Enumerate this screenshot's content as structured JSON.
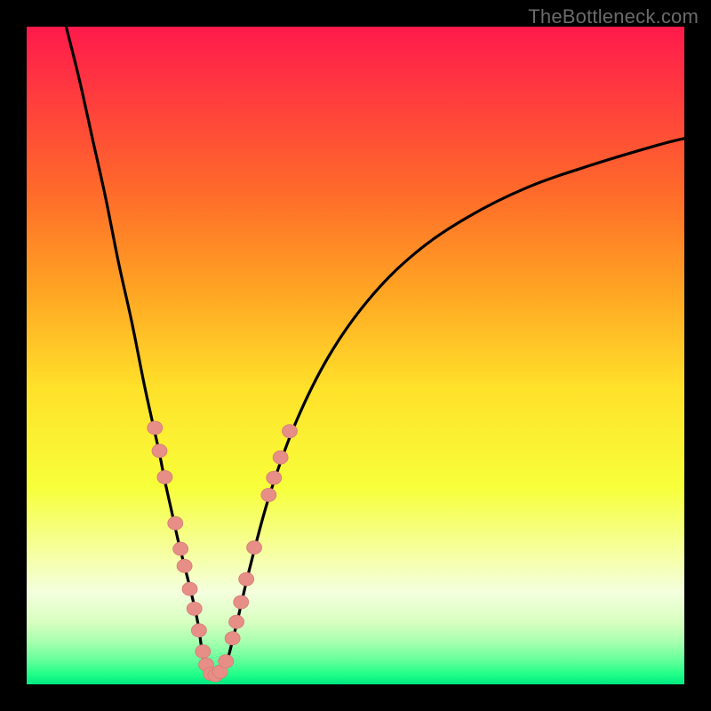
{
  "watermark": {
    "text": "TheBottleneck.com"
  },
  "colors": {
    "black": "#000000",
    "curve": "#000000",
    "marker": "#e78e87",
    "marker_stroke": "#d57c76"
  },
  "gradient_stops": [
    {
      "offset": 0.0,
      "color": "#ff1a4c"
    },
    {
      "offset": 0.1,
      "color": "#ff3a3f"
    },
    {
      "offset": 0.25,
      "color": "#ff6a2a"
    },
    {
      "offset": 0.4,
      "color": "#ffa423"
    },
    {
      "offset": 0.55,
      "color": "#ffe12a"
    },
    {
      "offset": 0.7,
      "color": "#f7ff3a"
    },
    {
      "offset": 0.8,
      "color": "#f6ffa0"
    },
    {
      "offset": 0.86,
      "color": "#f4ffde"
    },
    {
      "offset": 0.905,
      "color": "#d8ffc0"
    },
    {
      "offset": 0.935,
      "color": "#a8ffb0"
    },
    {
      "offset": 0.965,
      "color": "#60ff9a"
    },
    {
      "offset": 0.985,
      "color": "#20ff88"
    },
    {
      "offset": 1.0,
      "color": "#00e882"
    }
  ],
  "chart_data": {
    "type": "line",
    "title": "",
    "xlabel": "",
    "ylabel": "",
    "xlim": [
      0,
      100
    ],
    "ylim": [
      0,
      100
    ],
    "grid": false,
    "note": "Decorative bottleneck-style V curve on red→yellow→green gradient; x/y in percent of plot area (y = value height from bottom).",
    "series": [
      {
        "name": "left-branch",
        "x": [
          6,
          8,
          10,
          12,
          14,
          16,
          18,
          20,
          21,
          22,
          23,
          24,
          25,
          26,
          26.75
        ],
        "y": [
          100,
          92,
          83,
          74,
          64,
          55,
          45,
          36,
          31,
          26.5,
          22,
          18,
          14,
          9.5,
          4.5
        ]
      },
      {
        "name": "valley",
        "x": [
          26.75,
          27.25,
          28,
          29,
          30,
          30.75
        ],
        "y": [
          4.5,
          2.3,
          1.2,
          1.2,
          2.3,
          4.5
        ]
      },
      {
        "name": "right-branch",
        "x": [
          30.75,
          32,
          34,
          37,
          41,
          46,
          52,
          59,
          67,
          76,
          86,
          96,
          100
        ],
        "y": [
          4.5,
          9.5,
          18,
          29,
          40,
          50,
          58.5,
          65.5,
          71,
          75.5,
          79,
          82,
          83
        ]
      }
    ],
    "markers": {
      "name": "highlighted-points",
      "points": [
        {
          "x": 19.5,
          "y": 39
        },
        {
          "x": 20.2,
          "y": 35.5
        },
        {
          "x": 21.0,
          "y": 31.5
        },
        {
          "x": 22.6,
          "y": 24.5
        },
        {
          "x": 23.4,
          "y": 20.6
        },
        {
          "x": 24.0,
          "y": 18.0
        },
        {
          "x": 24.8,
          "y": 14.5
        },
        {
          "x": 25.5,
          "y": 11.5
        },
        {
          "x": 26.2,
          "y": 8.2
        },
        {
          "x": 26.8,
          "y": 5.0
        },
        {
          "x": 27.3,
          "y": 3.0
        },
        {
          "x": 28.0,
          "y": 1.6
        },
        {
          "x": 28.7,
          "y": 1.4
        },
        {
          "x": 29.4,
          "y": 1.9
        },
        {
          "x": 30.3,
          "y": 3.5
        },
        {
          "x": 31.3,
          "y": 7.0
        },
        {
          "x": 31.9,
          "y": 9.5
        },
        {
          "x": 32.6,
          "y": 12.5
        },
        {
          "x": 33.4,
          "y": 16.0
        },
        {
          "x": 34.6,
          "y": 20.8
        },
        {
          "x": 36.8,
          "y": 28.8
        },
        {
          "x": 37.6,
          "y": 31.4
        },
        {
          "x": 38.6,
          "y": 34.5
        },
        {
          "x": 40.0,
          "y": 38.5
        }
      ]
    }
  }
}
